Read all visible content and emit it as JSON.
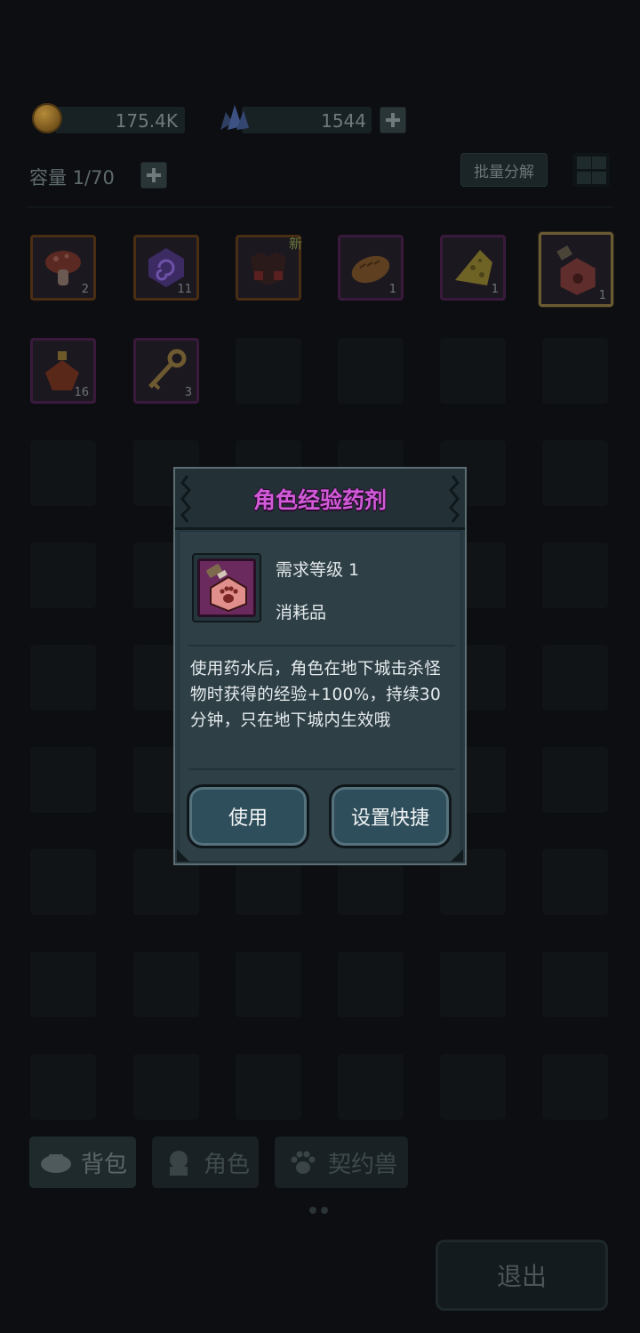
{
  "currency": {
    "coins": "175.4K",
    "gems": "1544"
  },
  "inventory": {
    "capacity_label": "容量 1/70",
    "batch_decompose_label": "批量分解",
    "new_tag": "新",
    "items": [
      {
        "name": "mushroom",
        "count": "2"
      },
      {
        "name": "purple-rune",
        "count": "11"
      },
      {
        "name": "dark-armor",
        "count": ""
      },
      {
        "name": "bread",
        "count": "1"
      },
      {
        "name": "cheese",
        "count": "1"
      },
      {
        "name": "exp-potion",
        "count": "1"
      },
      {
        "name": "elixir-flask",
        "count": "16"
      },
      {
        "name": "key",
        "count": "3"
      }
    ]
  },
  "tabs": [
    {
      "label": "背包",
      "icon": "bag-icon"
    },
    {
      "label": "角色",
      "icon": "character-icon"
    },
    {
      "label": "契约兽",
      "icon": "paw-icon"
    }
  ],
  "exit_label": "退出",
  "modal": {
    "title": "角色经验药剂",
    "required_level": "需求等级 1",
    "item_type": "消耗品",
    "description": "使用药水后，角色在地下城击杀怪物时获得的经验+100%，持续30分钟，只在地下城内生效哦",
    "use_label": "使用",
    "shortcut_label": "设置快捷",
    "title_color": "#d05ad8"
  }
}
